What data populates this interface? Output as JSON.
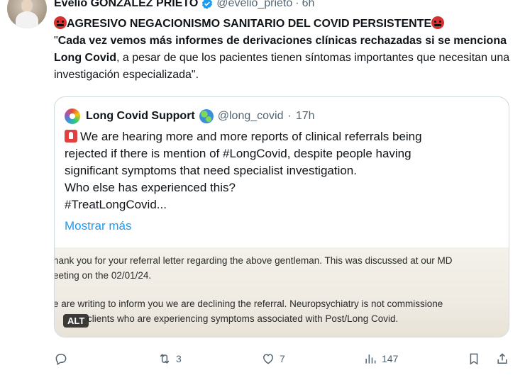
{
  "author": {
    "name": "Evelio GONZÁLEZ PRIETO",
    "handle": "@evelio_prieto",
    "separator": "·",
    "time": "6h"
  },
  "tweet": {
    "line1": "AGRESIVO NEGACIONISMO SANITARIO DEL COVID PERSISTENTE",
    "quote_open": "\"",
    "bold_text": "Cada vez vemos más informes de derivaciones clínicas rechazadas si se menciona Long Covid",
    "rest_text": ", a pesar de que los pacientes tienen síntomas importantes que necesitan una investigación especializada\"."
  },
  "quoted": {
    "name": "Long Covid Support",
    "handle": "@long_covid",
    "separator": "·",
    "time": "17h",
    "line1": "We are hearing more and more reports of clinical referrals being",
    "line2": "rejected if there is mention of #LongCovid, despite people having",
    "line3": "significant symptoms that need specialist investigation.",
    "line4": "Who else has experienced this?",
    "line5": "#TreatLongCovid...",
    "show_more": "Mostrar más",
    "image": {
      "line1": "hank you for your referral letter regarding the above gentleman. This was discussed at our MD",
      "line2": "eeting on the 02/01/24.",
      "line3": "e are writing to inform you we are declining the referral. Neuropsychiatry is not commissione",
      "line4": "clients who are experiencing symptoms associated with Post/Long Covid.",
      "alt_badge": "ALT"
    }
  },
  "actions": {
    "reply_count": "",
    "retweet_count": "3",
    "like_count": "7",
    "views_count": "147"
  }
}
